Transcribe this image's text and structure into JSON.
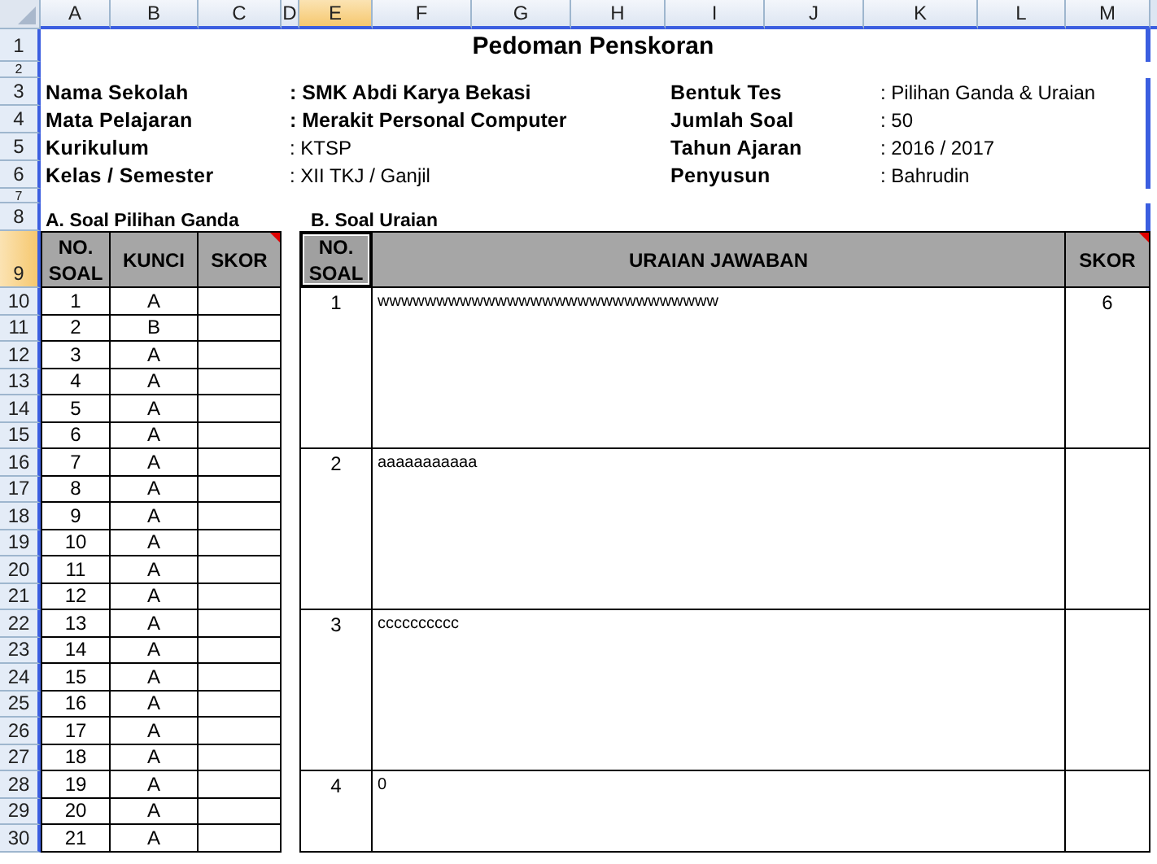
{
  "column_headers": [
    {
      "label": "A",
      "selected": false
    },
    {
      "label": "B",
      "selected": false
    },
    {
      "label": "C",
      "selected": false
    },
    {
      "label": "D",
      "selected": false
    },
    {
      "label": "E",
      "selected": true
    },
    {
      "label": "F",
      "selected": false
    },
    {
      "label": "G",
      "selected": false
    },
    {
      "label": "H",
      "selected": false
    },
    {
      "label": "I",
      "selected": false
    },
    {
      "label": "J",
      "selected": false
    },
    {
      "label": "K",
      "selected": false
    },
    {
      "label": "L",
      "selected": false
    },
    {
      "label": "M",
      "selected": false
    }
  ],
  "row_headers": [
    {
      "label": "1",
      "selected": false
    },
    {
      "label": "2",
      "selected": false
    },
    {
      "label": "3",
      "selected": false
    },
    {
      "label": "4",
      "selected": false
    },
    {
      "label": "5",
      "selected": false
    },
    {
      "label": "6",
      "selected": false
    },
    {
      "label": "7",
      "selected": false
    },
    {
      "label": "8",
      "selected": false
    },
    {
      "label": "9",
      "selected": true
    },
    {
      "label": "10",
      "selected": false
    },
    {
      "label": "11",
      "selected": false
    },
    {
      "label": "12",
      "selected": false
    },
    {
      "label": "13",
      "selected": false
    },
    {
      "label": "14",
      "selected": false
    },
    {
      "label": "15",
      "selected": false
    },
    {
      "label": "16",
      "selected": false
    },
    {
      "label": "17",
      "selected": false
    },
    {
      "label": "18",
      "selected": false
    },
    {
      "label": "19",
      "selected": false
    },
    {
      "label": "20",
      "selected": false
    },
    {
      "label": "21",
      "selected": false
    },
    {
      "label": "22",
      "selected": false
    },
    {
      "label": "23",
      "selected": false
    },
    {
      "label": "24",
      "selected": false
    },
    {
      "label": "25",
      "selected": false
    },
    {
      "label": "26",
      "selected": false
    },
    {
      "label": "27",
      "selected": false
    },
    {
      "label": "28",
      "selected": false
    },
    {
      "label": "29",
      "selected": false
    },
    {
      "label": "30",
      "selected": false
    }
  ],
  "title": "Pedoman Penskoran",
  "info_left": [
    {
      "label": "Nama Sekolah",
      "value": ": SMK Abdi Karya Bekasi",
      "bold": true
    },
    {
      "label": "Mata Pelajaran",
      "value": ": Merakit Personal Computer",
      "bold": true
    },
    {
      "label": "Kurikulum",
      "value": ": KTSP",
      "bold": false
    },
    {
      "label": "Kelas / Semester",
      "value": ": XII TKJ / Ganjil",
      "bold": false
    }
  ],
  "info_right": [
    {
      "label": "Bentuk Tes",
      "value": ": Pilihan Ganda & Uraian"
    },
    {
      "label": "Jumlah Soal",
      "value": ": 50"
    },
    {
      "label": "Tahun Ajaran",
      "value": ": 2016 / 2017"
    },
    {
      "label": "Penyusun",
      "value": ": Bahrudin"
    }
  ],
  "multiple_choice": {
    "title": "A. Soal Pilihan Ganda",
    "columns": [
      {
        "label": "NO. SOAL",
        "selected": false,
        "comment": false
      },
      {
        "label": "KUNCI",
        "selected": false,
        "comment": false
      },
      {
        "label": "SKOR",
        "selected": false,
        "comment": true
      }
    ],
    "rows": [
      {
        "number": "1",
        "key": "A"
      },
      {
        "number": "2",
        "key": "B"
      },
      {
        "number": "3",
        "key": "A"
      },
      {
        "number": "4",
        "key": "A"
      },
      {
        "number": "5",
        "key": "A"
      },
      {
        "number": "6",
        "key": "A"
      },
      {
        "number": "7",
        "key": "A"
      },
      {
        "number": "8",
        "key": "A"
      },
      {
        "number": "9",
        "key": "A"
      },
      {
        "number": "10",
        "key": "A"
      },
      {
        "number": "11",
        "key": "A"
      },
      {
        "number": "12",
        "key": "A"
      },
      {
        "number": "13",
        "key": "A"
      },
      {
        "number": "14",
        "key": "A"
      },
      {
        "number": "15",
        "key": "A"
      },
      {
        "number": "16",
        "key": "A"
      },
      {
        "number": "17",
        "key": "A"
      },
      {
        "number": "18",
        "key": "A"
      },
      {
        "number": "19",
        "key": "A"
      },
      {
        "number": "20",
        "key": "A"
      },
      {
        "number": "21",
        "key": "A"
      }
    ]
  },
  "essay": {
    "title": "B. Soal Uraian",
    "columns": [
      {
        "label": "NO. SOAL",
        "selected": true,
        "comment": false
      },
      {
        "label": "URAIAN JAWABAN",
        "selected": false,
        "comment": false
      },
      {
        "label": "SKOR",
        "selected": false,
        "comment": true
      }
    ],
    "rows": [
      {
        "number": "1",
        "answer": "wwwwwwwwwwwwwwwwwwwwwwwwwwwww",
        "score": "6"
      },
      {
        "number": "2",
        "answer": "aaaaaaaaaaa"
      },
      {
        "number": "3",
        "answer": "cccccccccc"
      },
      {
        "number": "4",
        "answer": "0"
      }
    ]
  }
}
